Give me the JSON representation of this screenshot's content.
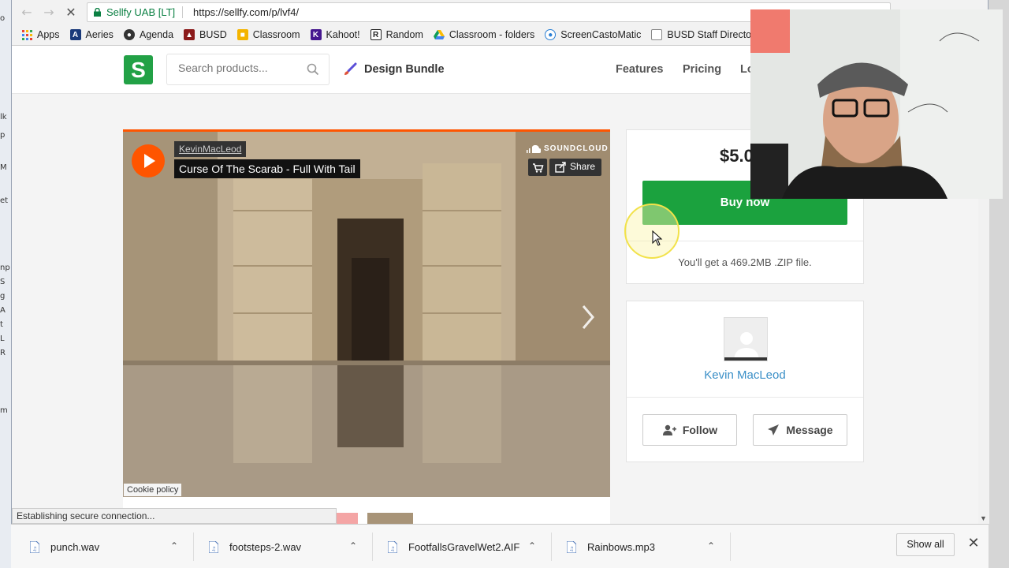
{
  "desktop": {
    "chips": [
      "o",
      "lk",
      "p",
      "M",
      "et",
      "np",
      "S",
      "g",
      "A",
      "t",
      "L",
      "R",
      "m"
    ]
  },
  "browser": {
    "tab_site_identity": "Sellfy UAB [LT]",
    "url": "https://sellfy.com/p/lvf4/",
    "bookmarks": [
      {
        "label": "Apps",
        "icon": "apps-grid-icon",
        "color": "#4285f4"
      },
      {
        "label": "Aeries",
        "icon": "aeries-icon",
        "color": "#1a3a7a"
      },
      {
        "label": "Agenda",
        "icon": "agenda-icon",
        "color": "#333333"
      },
      {
        "label": "BUSD",
        "icon": "busd-icon",
        "color": "#8b1a1a"
      },
      {
        "label": "Classroom",
        "icon": "classroom-icon",
        "color": "#f4b400"
      },
      {
        "label": "Kahoot!",
        "icon": "kahoot-icon",
        "color": "#46178f"
      },
      {
        "label": "Random",
        "icon": "random-icon",
        "color": "#222222"
      },
      {
        "label": "Classroom - folders",
        "icon": "drive-icon",
        "color": "#0f9d58"
      },
      {
        "label": "ScreenCastoMatic",
        "icon": "screencast-icon",
        "color": "#2a7fd4"
      },
      {
        "label": "BUSD Staff Directory",
        "icon": "page-icon",
        "color": "#888888"
      }
    ]
  },
  "site": {
    "logo_letter": "S",
    "search_placeholder": "Search products...",
    "design_bundle": "Design Bundle",
    "nav": [
      "Features",
      "Pricing",
      "Lo"
    ]
  },
  "player": {
    "artist": "KevinMacLeod",
    "track": "Curse Of The Scarab - Full With Tail",
    "provider": "SOUNDCLOUD",
    "share_label": "Share",
    "cookie_policy": "Cookie policy"
  },
  "purchase": {
    "price": "$5.0",
    "buy_label": "Buy now",
    "file_note": "You'll get a 469.2MB .ZIP file."
  },
  "seller": {
    "name": "Kevin MacLeod",
    "follow_label": "Follow",
    "message_label": "Message"
  },
  "status_text": "Establishing secure connection...",
  "downloads": {
    "items": [
      "punch.wav",
      "footsteps-2.wav",
      "FootfallsGravelWet2.AIF",
      "Rainbows.mp3"
    ],
    "show_all": "Show all"
  },
  "colors": {
    "brand_green": "#22a146",
    "buy_green": "#1ba23e",
    "soundcloud_orange": "#ff5500",
    "seller_link": "#3a8fc7"
  }
}
